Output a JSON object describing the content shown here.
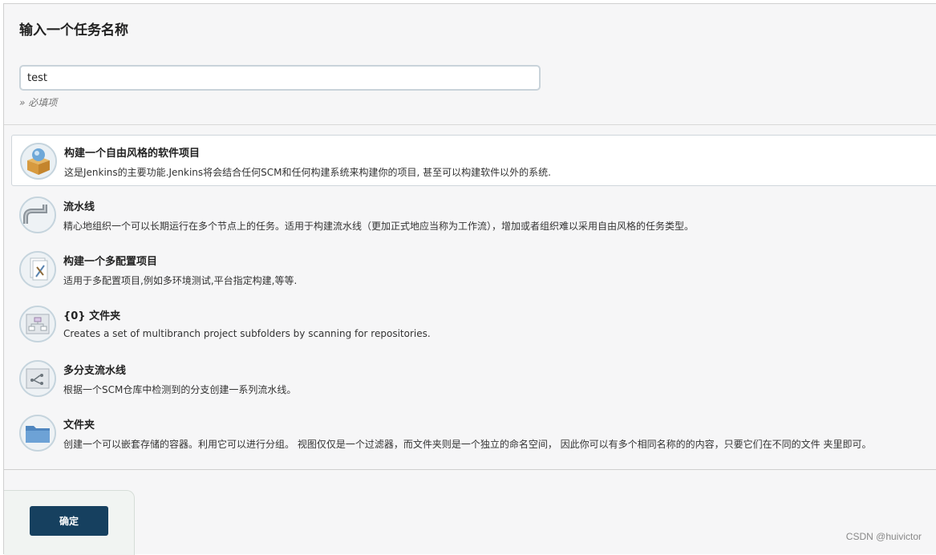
{
  "header": {
    "title": "输入一个任务名称"
  },
  "name_field": {
    "value": "test",
    "required_note": "» 必填项"
  },
  "items": [
    {
      "title": "构建一个自由风格的软件项目",
      "desc": "这是Jenkins的主要功能.Jenkins将会结合任何SCM和任何构建系统来构建你的项目, 甚至可以构建软件以外的系统.",
      "icon": "freestyle-box-icon",
      "selected": true
    },
    {
      "title": "流水线",
      "desc": "精心地组织一个可以长期运行在多个节点上的任务。适用于构建流水线（更加正式地应当称为工作流），增加或者组织难以采用自由风格的任务类型。",
      "icon": "pipeline-icon",
      "selected": false
    },
    {
      "title": "构建一个多配置项目",
      "desc": "适用于多配置项目,例如多环境测试,平台指定构建,等等.",
      "icon": "multi-config-icon",
      "selected": false
    },
    {
      "title": "{0} 文件夹",
      "desc": "Creates a set of multibranch project subfolders by scanning for repositories.",
      "icon": "org-folder-icon",
      "selected": false
    },
    {
      "title": "多分支流水线",
      "desc": "根据一个SCM仓库中检测到的分支创建一系列流水线。",
      "icon": "multibranch-pipeline-icon",
      "selected": false
    },
    {
      "title": "文件夹",
      "desc": "创建一个可以嵌套存储的容器。利用它可以进行分组。 视图仅仅是一个过滤器，而文件夹则是一个独立的命名空间， 因此你可以有多个相同名称的的内容，只要它们在不同的文件 夹里即可。",
      "icon": "folder-icon",
      "selected": false
    }
  ],
  "footer": {
    "ok_label": "确定"
  },
  "watermark": "CSDN @huivictor",
  "colors": {
    "button_bg": "#16405f",
    "selected_border": "#cfd6db"
  }
}
